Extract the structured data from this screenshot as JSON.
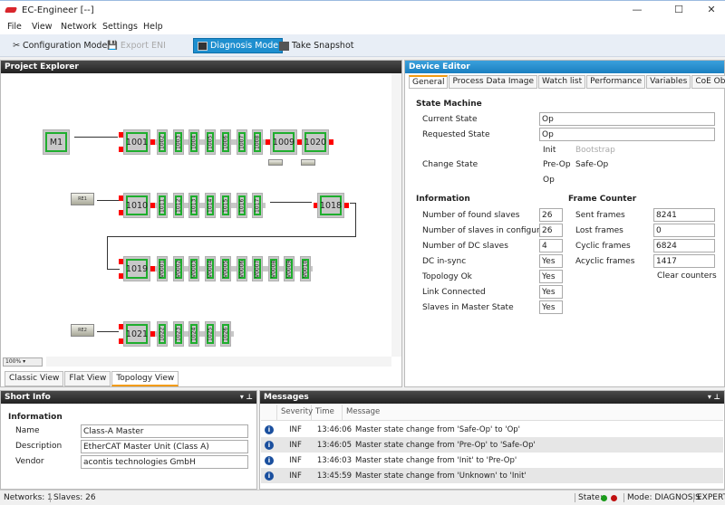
{
  "window": {
    "title": "EC-Engineer [--]",
    "minimize": "—",
    "maximize": "☐",
    "close": "✕"
  },
  "menu": [
    "File",
    "View",
    "Network",
    "Settings",
    "Help"
  ],
  "toolbar": {
    "config": "Configuration Mode",
    "export": "Export ENI",
    "diagnosis": "Diagnosis Mode",
    "snapshot": "Take Snapshot"
  },
  "project_explorer": {
    "title": "Project Explorer",
    "zoom": "100%",
    "tabs": [
      "Classic View",
      "Flat View",
      "Topology View"
    ],
    "topology": {
      "master": "M1",
      "row1": {
        "head": "1001",
        "slaves": [
          "1002",
          "1003",
          "1004",
          "1005",
          "1006",
          "1007",
          "1008"
        ],
        "tail": [
          "1009",
          "1020"
        ]
      },
      "row2": {
        "junction": "RE1",
        "head": "1010",
        "slaves": [
          "1011",
          "1012",
          "1013",
          "1014",
          "1015",
          "1016",
          "1017"
        ],
        "tail": [
          "1018"
        ]
      },
      "row3": {
        "head": "1019",
        "slaves": [
          "V0001",
          "V0002",
          "V0003",
          "V0004",
          "V0005",
          "V0006",
          "V0007",
          "V0008",
          "V0009",
          "V0010"
        ]
      },
      "row4": {
        "junction": "RE2",
        "head": "1021",
        "slaves": [
          "1022",
          "1023",
          "1024",
          "1025",
          "1026"
        ]
      }
    }
  },
  "device_editor": {
    "title": "Device Editor",
    "tabs": [
      "General",
      "Process Data Image",
      "Watch list",
      "Performance",
      "Variables",
      "CoE Object-D"
    ],
    "state_machine": {
      "title": "State Machine",
      "current_label": "Current State",
      "current": "Op",
      "requested_label": "Requested State",
      "requested": "Op",
      "change_label": "Change State",
      "buttons": {
        "init": "Init",
        "bootstrap": "Bootstrap",
        "preop": "Pre-Op",
        "safeop": "Safe-Op",
        "op": "Op"
      }
    },
    "information": {
      "title": "Information",
      "rows": [
        {
          "label": "Number of found slaves",
          "value": "26"
        },
        {
          "label": "Number of slaves in configuration",
          "value": "26"
        },
        {
          "label": "Number of DC slaves",
          "value": "4"
        },
        {
          "label": "DC in-sync",
          "value": "Yes"
        },
        {
          "label": "Topology Ok",
          "value": "Yes"
        },
        {
          "label": "Link Connected",
          "value": "Yes"
        },
        {
          "label": "Slaves in Master State",
          "value": "Yes"
        }
      ]
    },
    "frame_counter": {
      "title": "Frame Counter",
      "rows": [
        {
          "label": "Sent frames",
          "value": "8241"
        },
        {
          "label": "Lost frames",
          "value": "0"
        },
        {
          "label": "Cyclic frames",
          "value": "6824"
        },
        {
          "label": "Acyclic frames",
          "value": "1417"
        }
      ],
      "clear": "Clear counters"
    }
  },
  "short_info": {
    "title": "Short Info",
    "section": "Information",
    "rows": [
      {
        "label": "Name",
        "value": "Class-A Master"
      },
      {
        "label": "Description",
        "value": "EtherCAT Master Unit (Class A)"
      },
      {
        "label": "Vendor",
        "value": "acontis technologies GmbH"
      }
    ]
  },
  "messages": {
    "title": "Messages",
    "columns": [
      "Severity",
      "Time",
      "Message"
    ],
    "rows": [
      {
        "severity": "INF",
        "time": "13:46:06",
        "message": "Master state change from 'Safe-Op' to 'Op'"
      },
      {
        "severity": "INF",
        "time": "13:46:05",
        "message": "Master state change from 'Pre-Op' to 'Safe-Op'"
      },
      {
        "severity": "INF",
        "time": "13:46:03",
        "message": "Master state change from 'Init' to 'Pre-Op'"
      },
      {
        "severity": "INF",
        "time": "13:45:59",
        "message": "Master state change from 'Unknown' to 'Init'"
      }
    ]
  },
  "status": {
    "networks": "Networks: 1",
    "slaves": "Slaves: 26",
    "state": "State:",
    "mode": "Mode: DIAGNOSIS",
    "level": "EXPERT",
    "state_colors": [
      "#1a9a1a",
      "#c01010"
    ]
  }
}
